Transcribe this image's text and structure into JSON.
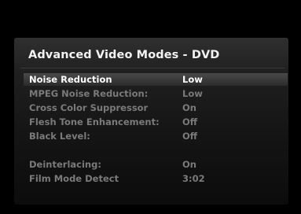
{
  "menu": {
    "title": "Advanced Video Modes - DVD",
    "items": [
      {
        "label": "Noise Reduction",
        "value": "Low"
      },
      {
        "label": "MPEG Noise Reduction:",
        "value": "Low"
      },
      {
        "label": "Cross Color Suppressor",
        "value": "On"
      },
      {
        "label": "Flesh Tone Enhancement:",
        "value": "Off"
      },
      {
        "label": "Black Level:",
        "value": "Off"
      },
      {
        "label": "Deinterlacing:",
        "value": "On"
      },
      {
        "label": "Film Mode Detect",
        "value": "3:02"
      }
    ]
  },
  "colors": {
    "selected_text": "#ffffff",
    "dimmed_text": "#7a7a7a",
    "panel": "#1f1f1f",
    "background": "#000000"
  }
}
